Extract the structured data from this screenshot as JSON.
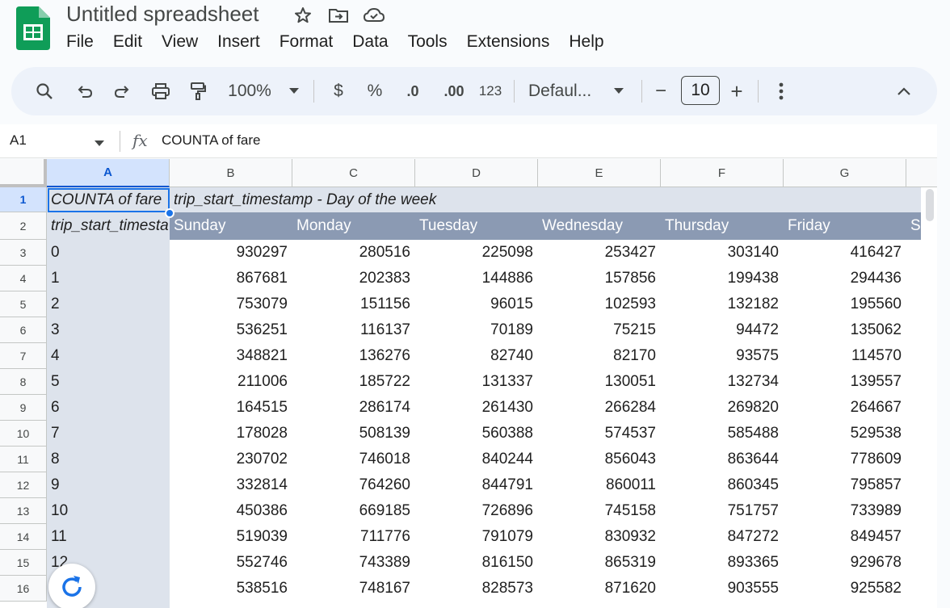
{
  "app": {
    "title": "Untitled spreadsheet",
    "menu": [
      "File",
      "Edit",
      "View",
      "Insert",
      "Format",
      "Data",
      "Tools",
      "Extensions",
      "Help"
    ]
  },
  "toolbar": {
    "zoom": "100%",
    "currency": "$",
    "percent": "%",
    "decrease_decimal": ".0",
    "increase_decimal": ".00",
    "number_format": "123",
    "font": "Defaul...",
    "font_size_minus": "−",
    "font_size": "10",
    "font_size_plus": "+"
  },
  "formula_bar": {
    "cell_ref": "A1",
    "fx": "fx",
    "content": "COUNTA of fare"
  },
  "columns": [
    "A",
    "B",
    "C",
    "D",
    "E",
    "F",
    "G"
  ],
  "rows": [
    "1",
    "2",
    "3",
    "4",
    "5",
    "6",
    "7",
    "8",
    "9",
    "10",
    "11",
    "12",
    "13",
    "14",
    "15",
    "16"
  ],
  "cells": {
    "a1": "COUNTA of fare",
    "b1": "trip_start_timestamp - Day of the week",
    "a2": "trip_start_timesta",
    "days": [
      "Sunday",
      "Monday",
      "Tuesday",
      "Wednesday",
      "Thursday",
      "Friday",
      "S"
    ],
    "data": [
      [
        "0",
        "930297",
        "280516",
        "225098",
        "253427",
        "303140",
        "416427"
      ],
      [
        "1",
        "867681",
        "202383",
        "144886",
        "157856",
        "199438",
        "294436"
      ],
      [
        "2",
        "753079",
        "151156",
        "96015",
        "102593",
        "132182",
        "195560"
      ],
      [
        "3",
        "536251",
        "116137",
        "70189",
        "75215",
        "94472",
        "135062"
      ],
      [
        "4",
        "348821",
        "136276",
        "82740",
        "82170",
        "93575",
        "114570"
      ],
      [
        "5",
        "211006",
        "185722",
        "131337",
        "130051",
        "132734",
        "139557"
      ],
      [
        "6",
        "164515",
        "286174",
        "261430",
        "266284",
        "269820",
        "264667"
      ],
      [
        "7",
        "178028",
        "508139",
        "560388",
        "574537",
        "585488",
        "529538"
      ],
      [
        "8",
        "230702",
        "746018",
        "840244",
        "856043",
        "863644",
        "778609"
      ],
      [
        "9",
        "332814",
        "764260",
        "844791",
        "860011",
        "860345",
        "795857"
      ],
      [
        "10",
        "450386",
        "669185",
        "726896",
        "745158",
        "751757",
        "733989"
      ],
      [
        "11",
        "519039",
        "711776",
        "791079",
        "830932",
        "847272",
        "849457"
      ],
      [
        "12",
        "552746",
        "743389",
        "816150",
        "865319",
        "893365",
        "929678"
      ],
      [
        "",
        "538516",
        "748167",
        "828573",
        "871620",
        "903555",
        "925582"
      ]
    ]
  },
  "colors": {
    "accent": "#1a73e8",
    "header_band": "#8b9ab3",
    "light_band": "#dde3ec"
  }
}
